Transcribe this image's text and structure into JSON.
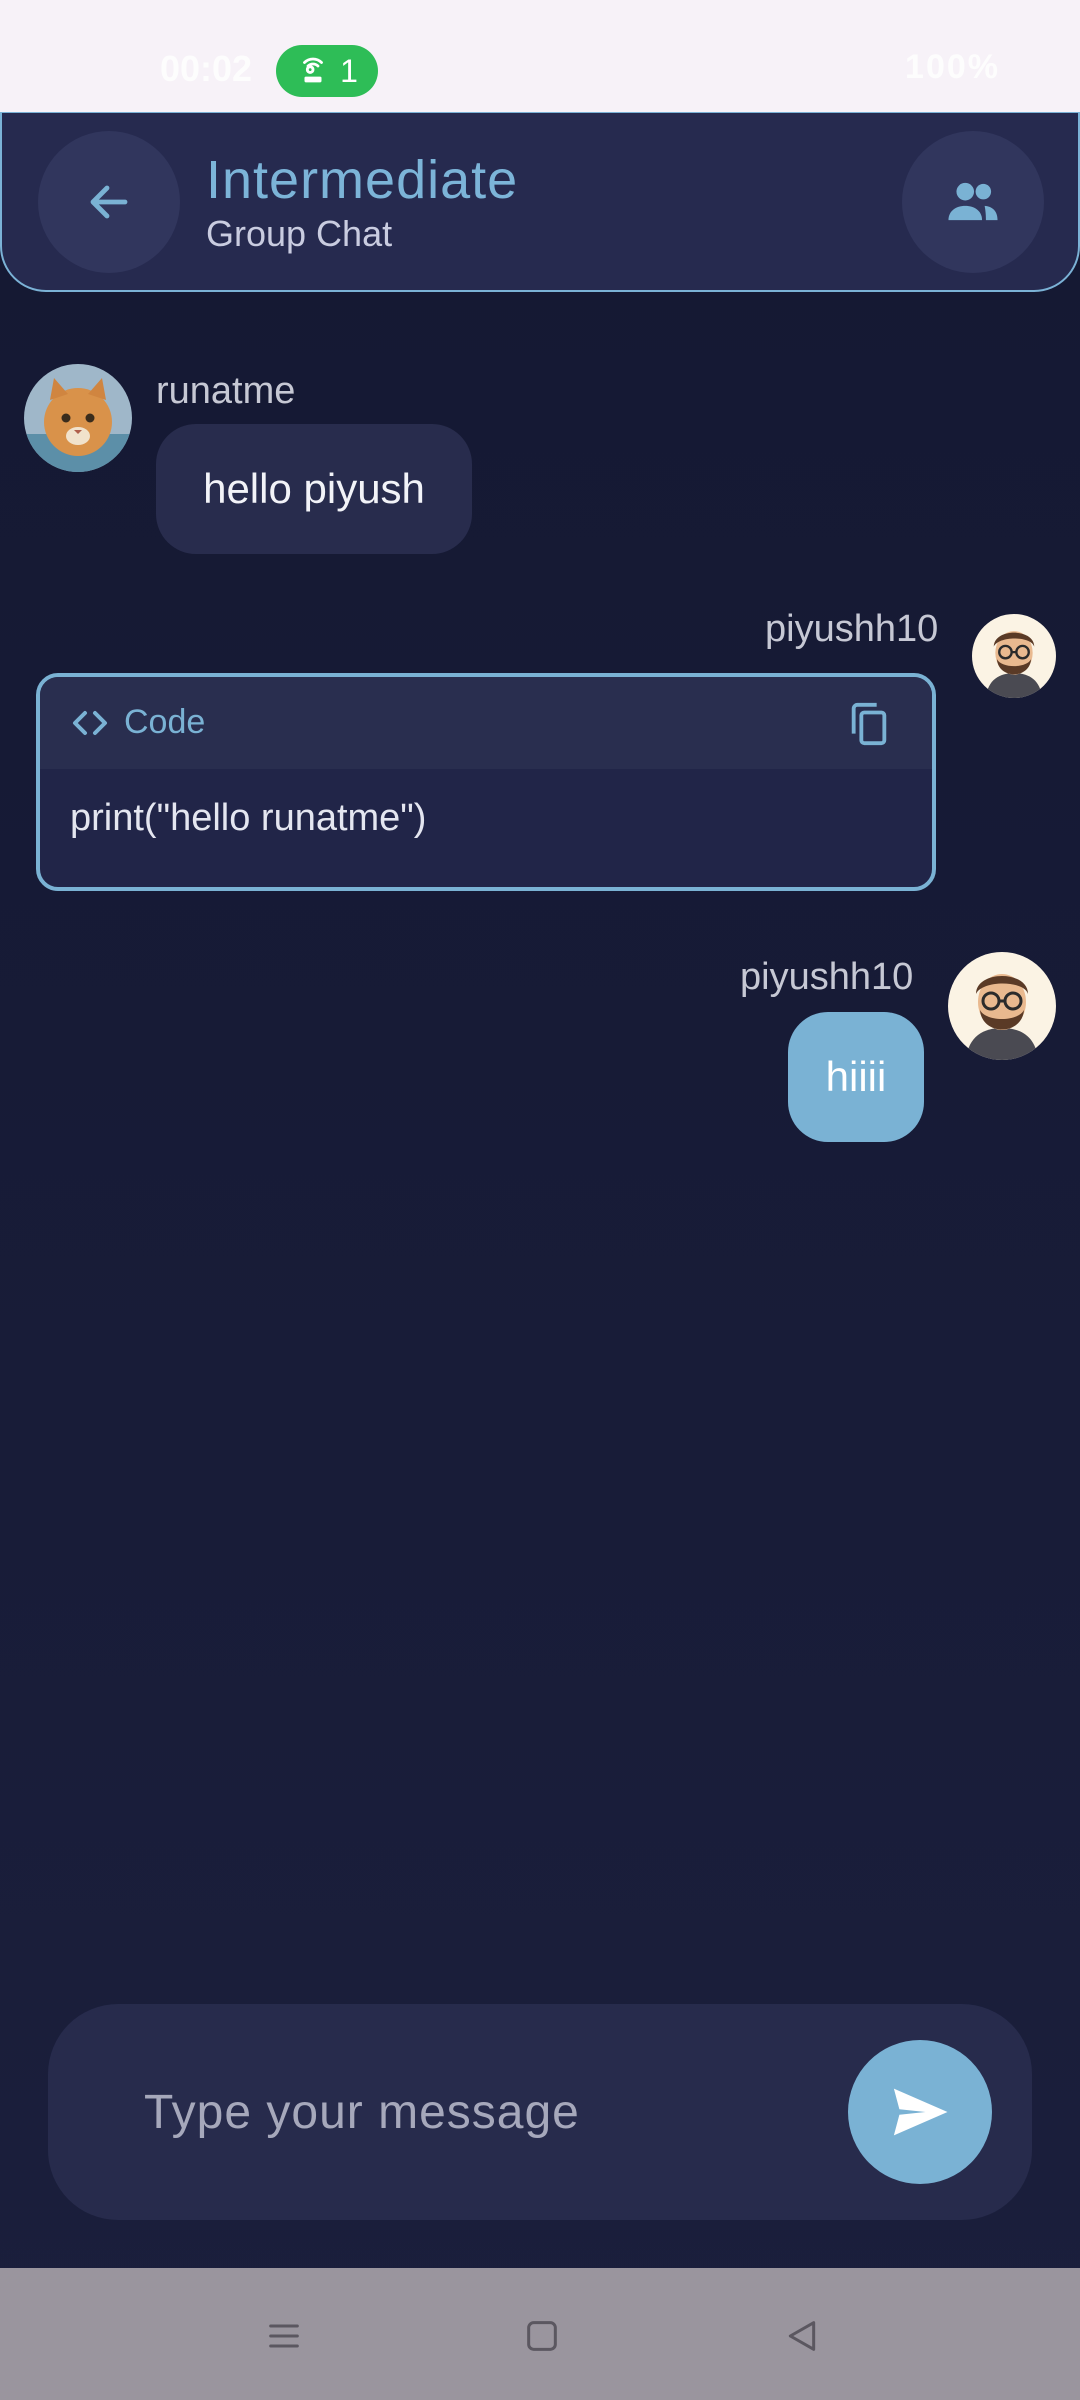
{
  "status_bar": {
    "time": "00:02",
    "hotspot_count": "1",
    "battery": "100%"
  },
  "header": {
    "title": "Intermediate",
    "subtitle": "Group Chat"
  },
  "messages": [
    {
      "sender": "runatme",
      "text": "hello piyush"
    },
    {
      "sender": "piyushh10",
      "code_label": "Code",
      "code": "print(\"hello runatme\")"
    },
    {
      "sender": "piyushh10",
      "text": "hiiii"
    }
  ],
  "composer": {
    "placeholder": "Type your message"
  },
  "colors": {
    "accent": "#7ab2d4",
    "background": "#161a33",
    "bubble_in": "#282c4d",
    "hotspot": "#2ebd57"
  },
  "icons": [
    "back-arrow-icon",
    "group-icon",
    "code-icon",
    "copy-icon",
    "send-icon",
    "menu-icon",
    "home-icon",
    "back-triangle-icon"
  ]
}
